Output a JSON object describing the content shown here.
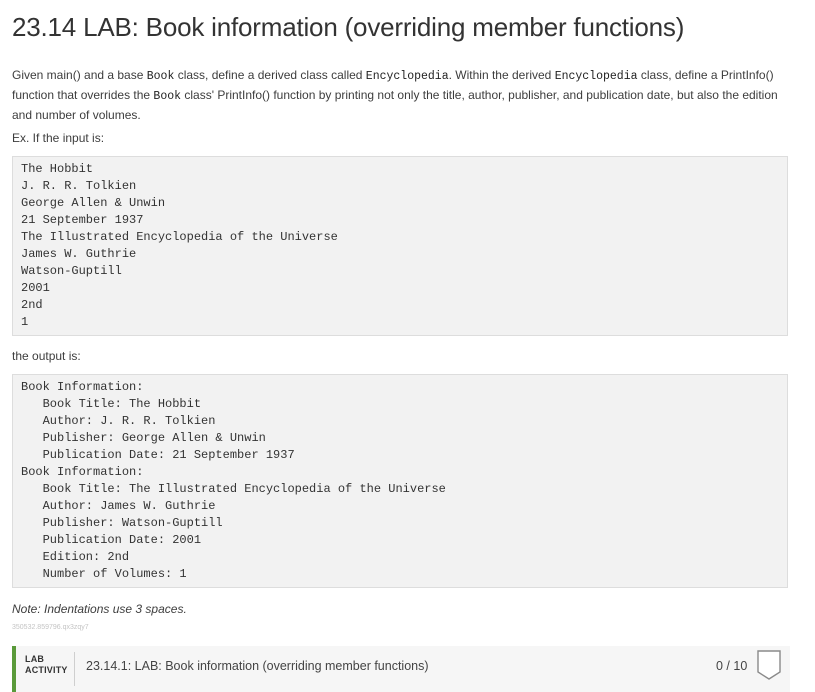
{
  "heading": "23.14 LAB: Book information (overriding member functions)",
  "description": {
    "part1": "Given main() and a base ",
    "code1": "Book",
    "part2": " class, define a derived class called ",
    "code2": "Encyclopedia",
    "part3": ". Within the derived ",
    "code3": "Encyclopedia",
    "part4": " class, define a PrintInfo() function that overrides the ",
    "code4": "Book",
    "part5": " class' PrintInfo() function by printing not only the title, author, publisher, and publication date, but also the edition and number of volumes."
  },
  "example_label": "Ex. If the input is:",
  "input_lines": [
    "The Hobbit",
    "J. R. R. Tolkien",
    "George Allen & Unwin",
    "21 September 1937",
    "The Illustrated Encyclopedia of the Universe",
    "James W. Guthrie",
    "Watson-Guptill",
    "2001",
    "2nd",
    "1"
  ],
  "output_label": "the output is:",
  "output_lines": [
    "Book Information:",
    "   Book Title: The Hobbit",
    "   Author: J. R. R. Tolkien",
    "   Publisher: George Allen & Unwin",
    "   Publication Date: 21 September 1937",
    "Book Information:",
    "   Book Title: The Illustrated Encyclopedia of the Universe",
    "   Author: James W. Guthrie",
    "   Publisher: Watson-Guptill",
    "   Publication Date: 2001",
    "   Edition: 2nd",
    "   Number of Volumes: 1"
  ],
  "note": "Note: Indentations use 3 spaces.",
  "activity_id": "350532.859796.qx3zqy7",
  "lab_activity": {
    "kind_line1": "LAB",
    "kind_line2": "ACTIVITY",
    "title": "23.14.1: LAB: Book information (overriding member functions)",
    "score": "0 / 10",
    "badge_icon": "score-badge-icon",
    "accent_color": "#5a9a3a"
  }
}
